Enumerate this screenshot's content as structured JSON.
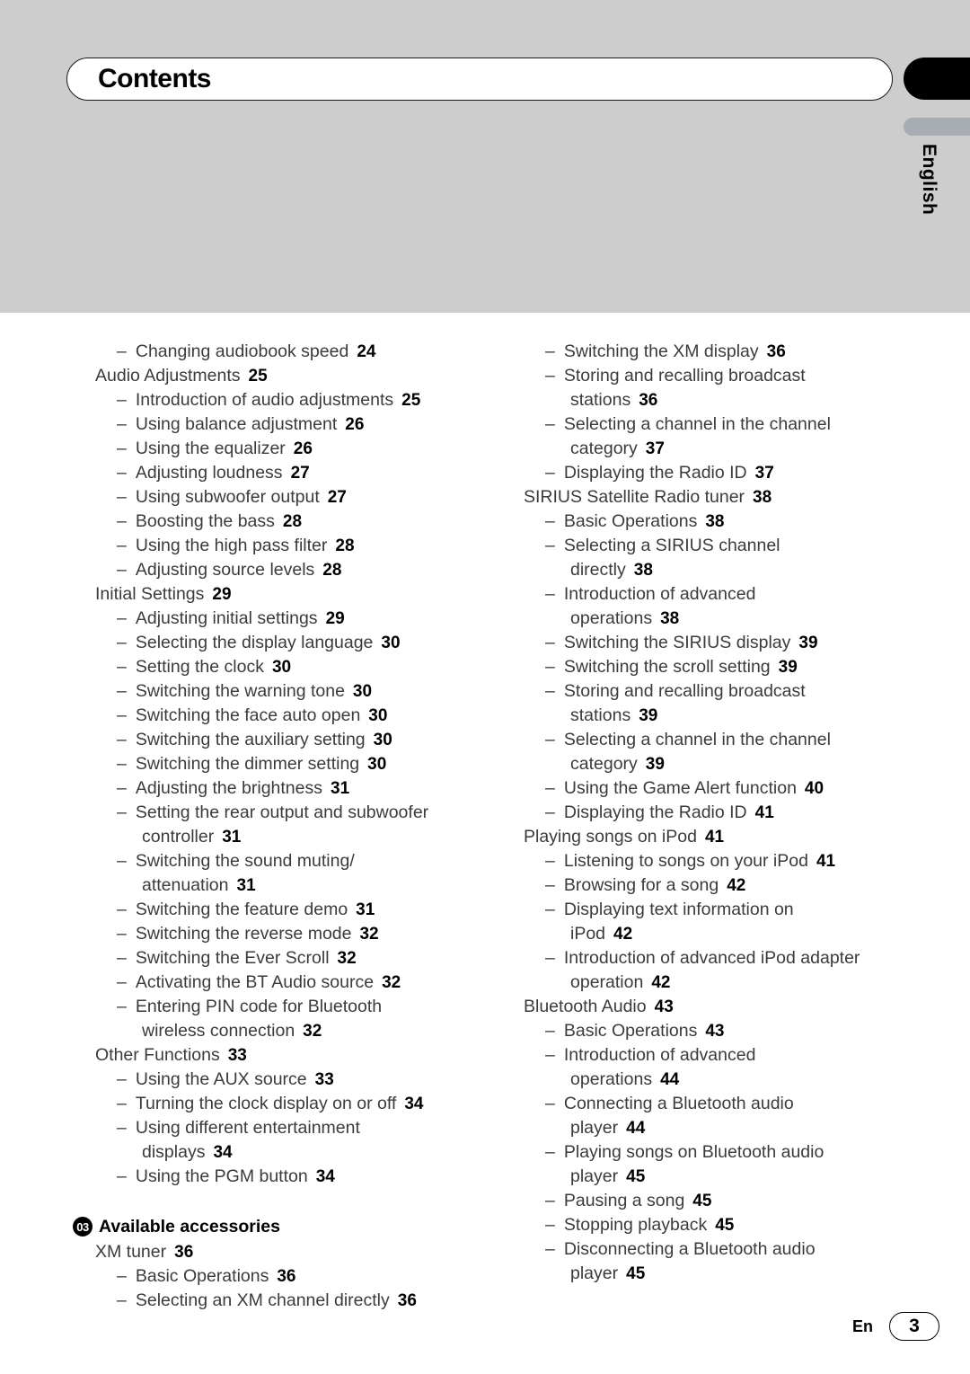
{
  "header": {
    "title": "Contents",
    "side_tab_language": "English"
  },
  "footer": {
    "language_code": "En",
    "page_number": "3"
  },
  "toc": {
    "left_column": [
      {
        "level": 2,
        "text": "Changing audiobook speed",
        "page": "24"
      },
      {
        "level": 1,
        "text": "Audio Adjustments",
        "page": "25"
      },
      {
        "level": 2,
        "text": "Introduction of audio adjustments",
        "page": "25"
      },
      {
        "level": 2,
        "text": "Using balance adjustment",
        "page": "26"
      },
      {
        "level": 2,
        "text": "Using the equalizer",
        "page": "26"
      },
      {
        "level": 2,
        "text": "Adjusting loudness",
        "page": "27"
      },
      {
        "level": 2,
        "text": "Using subwoofer output",
        "page": "27"
      },
      {
        "level": 2,
        "text": "Boosting the bass",
        "page": "28"
      },
      {
        "level": 2,
        "text": "Using the high pass filter",
        "page": "28"
      },
      {
        "level": 2,
        "text": "Adjusting source levels",
        "page": "28"
      },
      {
        "level": 1,
        "text": "Initial Settings",
        "page": "29"
      },
      {
        "level": 2,
        "text": "Adjusting initial settings",
        "page": "29"
      },
      {
        "level": 2,
        "text": "Selecting the display language",
        "page": "30"
      },
      {
        "level": 2,
        "text": "Setting the clock",
        "page": "30"
      },
      {
        "level": 2,
        "text": "Switching the warning tone",
        "page": "30"
      },
      {
        "level": 2,
        "text": "Switching the face auto open",
        "page": "30"
      },
      {
        "level": 2,
        "text": "Switching the auxiliary setting",
        "page": "30"
      },
      {
        "level": 2,
        "text": "Switching the dimmer setting",
        "page": "30"
      },
      {
        "level": 2,
        "text": "Adjusting the brightness",
        "page": "31"
      },
      {
        "level": 2,
        "text": "Setting the rear output and subwoofer",
        "page": ""
      },
      {
        "level": 3,
        "text": "controller",
        "page": "31"
      },
      {
        "level": 2,
        "text": "Switching the sound muting/",
        "page": ""
      },
      {
        "level": 3,
        "text": "attenuation",
        "page": "31"
      },
      {
        "level": 2,
        "text": "Switching the feature demo",
        "page": "31"
      },
      {
        "level": 2,
        "text": "Switching the reverse mode",
        "page": "32"
      },
      {
        "level": 2,
        "text": "Switching the Ever Scroll",
        "page": "32"
      },
      {
        "level": 2,
        "text": "Activating the BT Audio source",
        "page": "32"
      },
      {
        "level": 2,
        "text": "Entering PIN code for Bluetooth",
        "page": ""
      },
      {
        "level": 3,
        "text": "wireless connection",
        "page": "32"
      },
      {
        "level": 1,
        "text": "Other Functions",
        "page": "33"
      },
      {
        "level": 2,
        "text": "Using the AUX source",
        "page": "33"
      },
      {
        "level": 2,
        "text": "Turning the clock display on or off",
        "page": "34"
      },
      {
        "level": 2,
        "text": "Using different entertainment",
        "page": ""
      },
      {
        "level": 3,
        "text": "displays",
        "page": "34"
      },
      {
        "level": 2,
        "text": "Using the PGM button",
        "page": "34"
      },
      {
        "level": 0,
        "text": "",
        "page": ""
      },
      {
        "level": 9,
        "badge": "03",
        "text": "Available accessories",
        "page": ""
      },
      {
        "level": 1,
        "text": "XM tuner",
        "page": "36"
      },
      {
        "level": 2,
        "text": "Basic Operations",
        "page": "36"
      },
      {
        "level": 2,
        "text": "Selecting an XM channel directly",
        "page": "36"
      }
    ],
    "right_column": [
      {
        "level": 2,
        "text": "Switching the XM display",
        "page": "36"
      },
      {
        "level": 2,
        "text": "Storing and recalling broadcast",
        "page": ""
      },
      {
        "level": 3,
        "text": "stations",
        "page": "36"
      },
      {
        "level": 2,
        "text": "Selecting a channel in the channel",
        "page": ""
      },
      {
        "level": 3,
        "text": "category",
        "page": "37"
      },
      {
        "level": 2,
        "text": "Displaying the Radio ID",
        "page": "37"
      },
      {
        "level": 1,
        "text": "SIRIUS Satellite Radio tuner",
        "page": "38"
      },
      {
        "level": 2,
        "text": "Basic Operations",
        "page": "38"
      },
      {
        "level": 2,
        "text": "Selecting a SIRIUS channel",
        "page": ""
      },
      {
        "level": 3,
        "text": "directly",
        "page": "38"
      },
      {
        "level": 2,
        "text": "Introduction of advanced",
        "page": ""
      },
      {
        "level": 3,
        "text": "operations",
        "page": "38"
      },
      {
        "level": 2,
        "text": "Switching the SIRIUS display",
        "page": "39"
      },
      {
        "level": 2,
        "text": "Switching the scroll setting",
        "page": "39"
      },
      {
        "level": 2,
        "text": "Storing and recalling broadcast",
        "page": ""
      },
      {
        "level": 3,
        "text": "stations",
        "page": "39"
      },
      {
        "level": 2,
        "text": "Selecting a channel in the channel",
        "page": ""
      },
      {
        "level": 3,
        "text": "category",
        "page": "39"
      },
      {
        "level": 2,
        "text": "Using the Game Alert function",
        "page": "40"
      },
      {
        "level": 2,
        "text": "Displaying the Radio ID",
        "page": "41"
      },
      {
        "level": 1,
        "text": "Playing songs on iPod",
        "page": "41"
      },
      {
        "level": 2,
        "text": "Listening to songs on your iPod",
        "page": "41"
      },
      {
        "level": 2,
        "text": "Browsing for a song",
        "page": "42"
      },
      {
        "level": 2,
        "text": "Displaying text information on",
        "page": ""
      },
      {
        "level": 3,
        "text": "iPod",
        "page": "42"
      },
      {
        "level": 2,
        "text": "Introduction of advanced iPod adapter",
        "page": ""
      },
      {
        "level": 3,
        "text": "operation",
        "page": "42"
      },
      {
        "level": 1,
        "text": "Bluetooth Audio",
        "page": "43"
      },
      {
        "level": 2,
        "text": "Basic Operations",
        "page": "43"
      },
      {
        "level": 2,
        "text": "Introduction of advanced",
        "page": ""
      },
      {
        "level": 3,
        "text": "operations",
        "page": "44"
      },
      {
        "level": 2,
        "text": "Connecting a Bluetooth audio",
        "page": ""
      },
      {
        "level": 3,
        "text": "player",
        "page": "44"
      },
      {
        "level": 2,
        "text": "Playing songs on Bluetooth audio",
        "page": ""
      },
      {
        "level": 3,
        "text": "player",
        "page": "45"
      },
      {
        "level": 2,
        "text": "Pausing a song",
        "page": "45"
      },
      {
        "level": 2,
        "text": "Stopping playback",
        "page": "45"
      },
      {
        "level": 2,
        "text": "Disconnecting a Bluetooth audio",
        "page": ""
      },
      {
        "level": 3,
        "text": "player",
        "page": "45"
      }
    ]
  },
  "symbols": {
    "dash": "–"
  },
  "colors": {
    "band_gray": "#cdcdcd",
    "tab_black": "#000000",
    "tab_gray": "#a8acb3",
    "text_gray": "#3b3b3b",
    "page_number_black": "#000000"
  }
}
